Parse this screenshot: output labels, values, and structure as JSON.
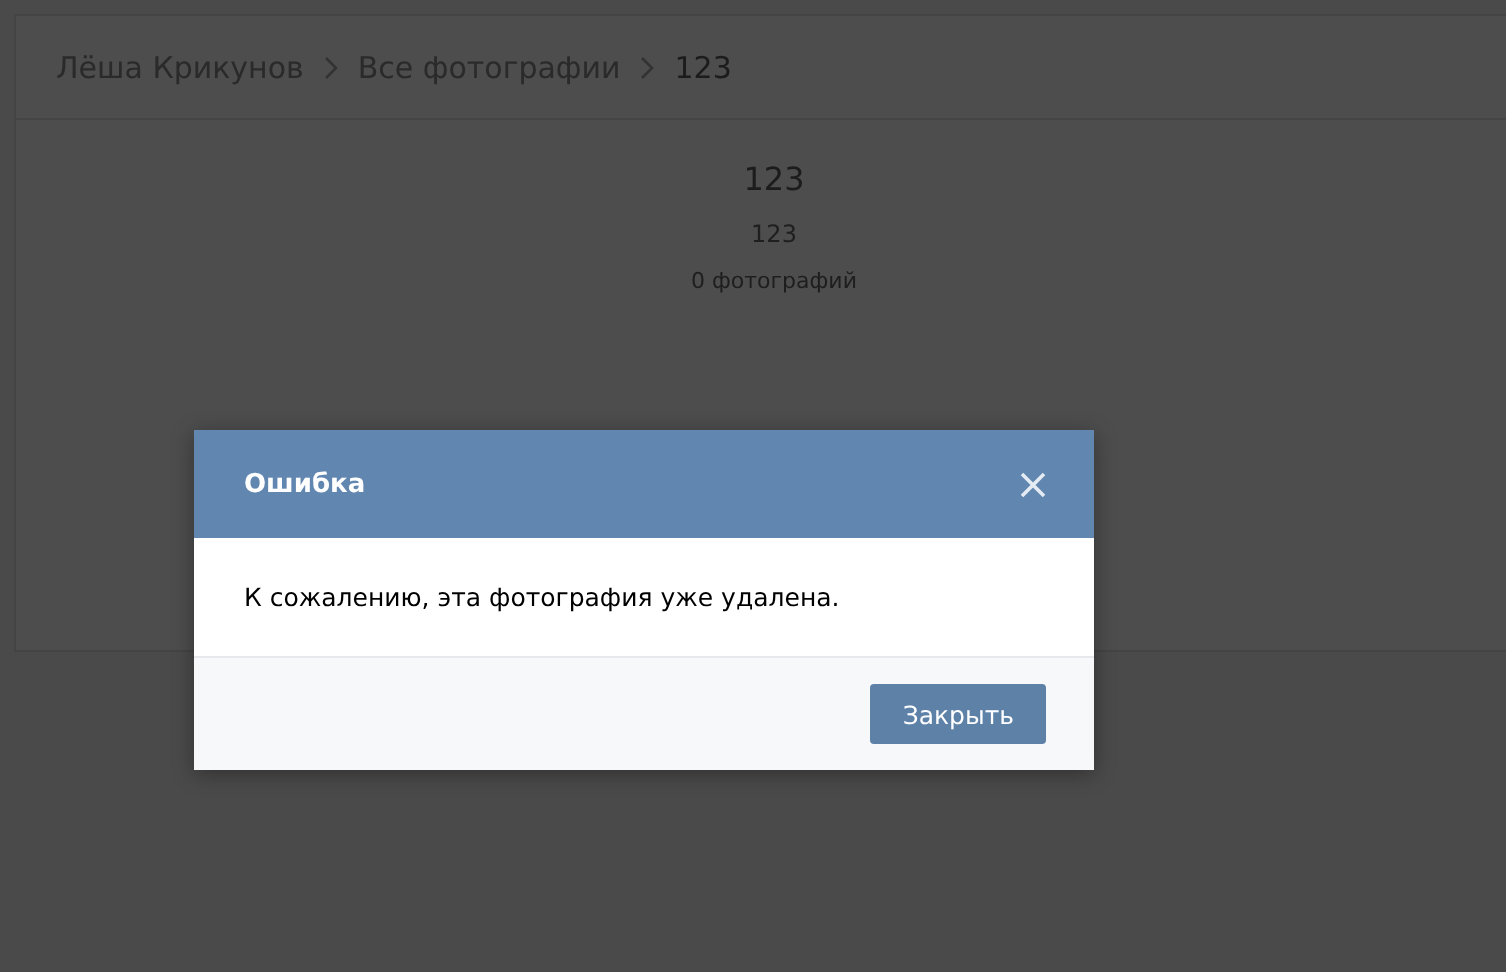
{
  "breadcrumbs": [
    "Лёша Крикунов",
    "Все фотографии",
    "123"
  ],
  "album": {
    "title": "123",
    "description": "123",
    "count": "0 фотографий"
  },
  "dialog": {
    "title": "Ошибка",
    "message": "К сожалению, эта фотография уже удалена.",
    "button": "Закрыть"
  }
}
